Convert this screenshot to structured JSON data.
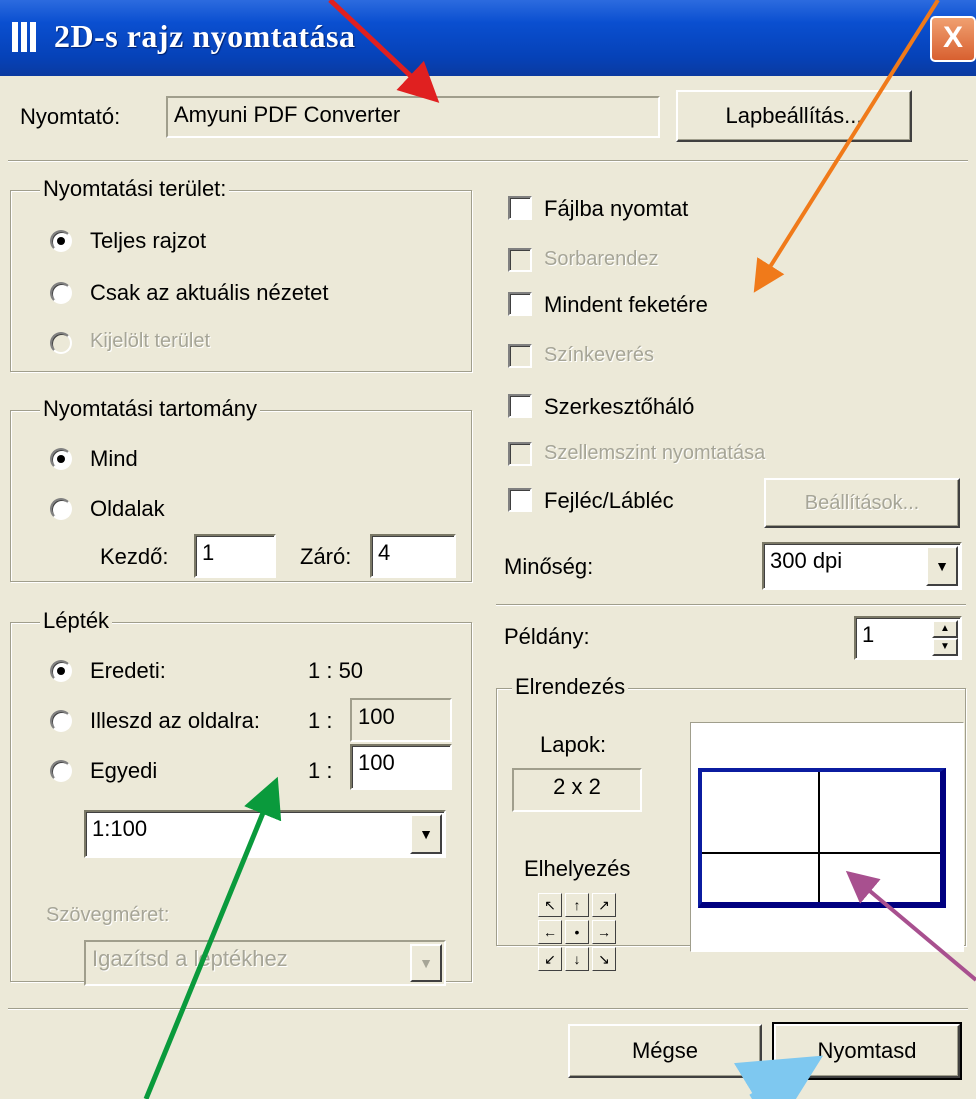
{
  "window": {
    "title": "2D-s rajz nyomtatása",
    "close_glyph": "X"
  },
  "printer": {
    "label": "Nyomtató:",
    "value": "Amyuni PDF Converter",
    "setup_button": "Lapbeállítás..."
  },
  "print_area": {
    "legend": "Nyomtatási terület:",
    "options": [
      {
        "label": "Teljes rajzot",
        "selected": true,
        "enabled": true
      },
      {
        "label": "Csak az aktuális nézetet",
        "selected": false,
        "enabled": true
      },
      {
        "label": "Kijelölt terület",
        "selected": false,
        "enabled": false
      }
    ]
  },
  "print_range": {
    "legend": "Nyomtatási tartomány",
    "options": [
      {
        "label": "Mind",
        "selected": true
      },
      {
        "label": "Oldalak",
        "selected": false
      }
    ],
    "from_label": "Kezdő:",
    "from_value": "1",
    "to_label": "Záró:",
    "to_value": "4"
  },
  "scale": {
    "legend": "Lépték",
    "original_label": "Eredeti:",
    "original_value": "1 : 50",
    "fit_label": "Illeszd az oldalra:",
    "fit_prefix": "1 :",
    "fit_value": "100",
    "custom_label": "Egyedi",
    "custom_prefix": "1 :",
    "custom_value": "100",
    "dropdown_value": "1:100",
    "text_size_label": "Szövegméret:",
    "text_size_value": "Igazítsd a léptékhez"
  },
  "options": {
    "print_to_file": "Fájlba nyomtat",
    "collate": "Sorbarendez",
    "all_black": "Mindent feketére",
    "color_mix": "Színkeverés",
    "edit_grid": "Szerkesztőháló",
    "ghost_story": "Szellemszint nyomtatása",
    "header_footer": "Fejléc/Lábléc",
    "settings_button": "Beállítások...",
    "quality_label": "Minőség:",
    "quality_value": "300 dpi",
    "copies_label": "Példány:",
    "copies_value": "1"
  },
  "layout": {
    "legend": "Elrendezés",
    "sheets_label": "Lapok:",
    "sheets_value": "2 x 2",
    "placement_label": "Elhelyezés",
    "placement_arrows": [
      "↖",
      "↑",
      "↗",
      "←",
      "•",
      "→",
      "↙",
      "↓",
      "↘"
    ]
  },
  "footer": {
    "cancel": "Mégse",
    "print": "Nyomtasd"
  },
  "colors": {
    "title_bar": "#0a4fd0",
    "dialog_bg": "#ece9d8",
    "preview_sheet_border": "#0b1ca0",
    "arrow_red": "#e02020",
    "arrow_orange": "#f07a1a",
    "arrow_green": "#0a9a3c",
    "arrow_purple": "#a8508f",
    "arrow_lightblue": "#7ec8f0"
  }
}
